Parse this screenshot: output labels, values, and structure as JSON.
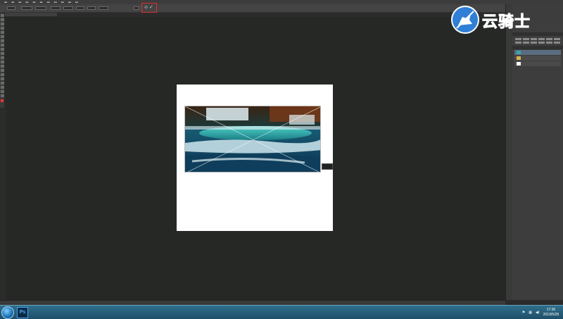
{
  "app": {
    "name": "Photoshop",
    "taskbar_label": "Ps"
  },
  "watermark": {
    "brand_text": "云骑士"
  },
  "options_bar": {
    "cancel_symbol": "⊘",
    "commit_symbol": "✓"
  },
  "status": {
    "zoom": "",
    "doc_info": ""
  },
  "taskbar": {
    "time": "17:36",
    "date": "2019/5/28"
  },
  "colors": {
    "highlight_box": "#e0302c",
    "brand_blue": "#1f6fd0",
    "document_bg": "#ffffff",
    "canvas_bg": "#262826"
  },
  "icons": {
    "start": "windows-start-icon",
    "photoshop": "photoshop-icon",
    "network": "network-icon",
    "volume": "volume-icon",
    "flag": "action-center-flag-icon"
  }
}
